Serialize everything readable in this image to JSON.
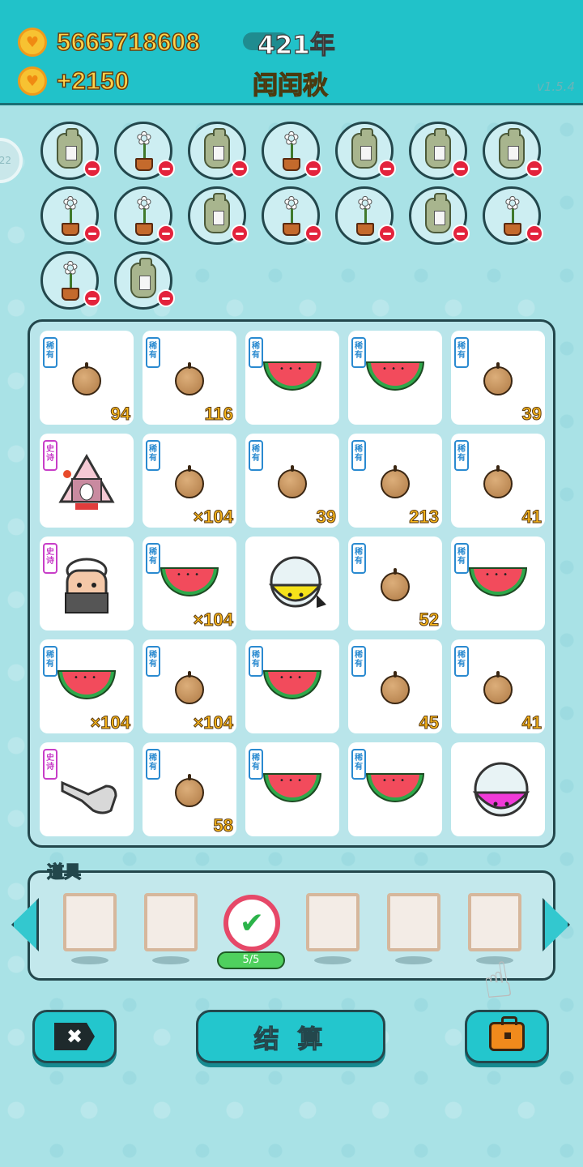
{
  "header": {
    "coins": "5665718608",
    "income": "+2150",
    "year": "421年",
    "season": "闰闰秋",
    "version": "v1.5.4",
    "side_badge": "22"
  },
  "tokens": [
    {
      "type": "bag"
    },
    {
      "type": "flower"
    },
    {
      "type": "bag"
    },
    {
      "type": "flower"
    },
    {
      "type": "bag"
    },
    {
      "type": "bag"
    },
    {
      "type": "bag"
    },
    {
      "type": "flower"
    },
    {
      "type": "flower"
    },
    {
      "type": "bag"
    },
    {
      "type": "flower"
    },
    {
      "type": "flower"
    },
    {
      "type": "bag"
    },
    {
      "type": "flower"
    },
    {
      "type": "flower"
    },
    {
      "type": "bag"
    }
  ],
  "grid": [
    {
      "item": "coconut",
      "tag": "稀有",
      "count": "94"
    },
    {
      "item": "coconut",
      "tag": "稀有",
      "count": "116"
    },
    {
      "item": "watermelon",
      "tag": "稀有",
      "count": ""
    },
    {
      "item": "watermelon",
      "tag": "稀有",
      "count": ""
    },
    {
      "item": "coconut",
      "tag": "稀有",
      "count": "39"
    },
    {
      "item": "rabbit-house",
      "tag": "史诗",
      "count": ""
    },
    {
      "item": "coconut",
      "tag": "稀有",
      "count": "×104"
    },
    {
      "item": "coconut",
      "tag": "稀有",
      "count": "39"
    },
    {
      "item": "coconut",
      "tag": "稀有",
      "count": "213"
    },
    {
      "item": "coconut",
      "tag": "稀有",
      "count": "41"
    },
    {
      "item": "old-man",
      "tag": "史诗",
      "count": ""
    },
    {
      "item": "watermelon",
      "tag": "稀有",
      "count": "×104"
    },
    {
      "item": "capsule-yellow",
      "tag": "",
      "count": ""
    },
    {
      "item": "coconut",
      "tag": "稀有",
      "count": "52"
    },
    {
      "item": "watermelon",
      "tag": "稀有",
      "count": ""
    },
    {
      "item": "watermelon",
      "tag": "稀有",
      "count": "×104"
    },
    {
      "item": "coconut",
      "tag": "稀有",
      "count": "×104"
    },
    {
      "item": "watermelon",
      "tag": "稀有",
      "count": ""
    },
    {
      "item": "coconut",
      "tag": "稀有",
      "count": "45"
    },
    {
      "item": "coconut",
      "tag": "稀有",
      "count": "41"
    },
    {
      "item": "pointing-hand",
      "tag": "史诗",
      "count": ""
    },
    {
      "item": "coconut",
      "tag": "稀有",
      "count": "58"
    },
    {
      "item": "watermelon",
      "tag": "稀有",
      "count": ""
    },
    {
      "item": "watermelon",
      "tag": "稀有",
      "count": ""
    },
    {
      "item": "capsule-pink",
      "tag": "",
      "count": ""
    }
  ],
  "tools": {
    "label": "道具",
    "progress": "5/5"
  },
  "buttons": {
    "settle": "结 算",
    "close_glyph": "✖"
  },
  "colors": {
    "header_bg": "#21c2c9",
    "coin_text": "#ffd34a",
    "rare": "#2a8ad0",
    "epic": "#c83ec8",
    "count": "#f9b61a"
  }
}
